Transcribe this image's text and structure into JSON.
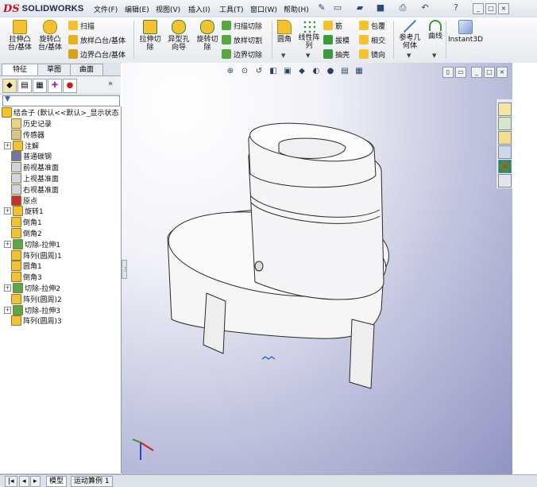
{
  "app": {
    "logo_ds": "DS",
    "logo_name": "SOLIDWORKS"
  },
  "menu": [
    "文件(F)",
    "编辑(E)",
    "视图(V)",
    "插入(I)",
    "工具(T)",
    "窗口(W)",
    "帮助(H)"
  ],
  "toolbar_icons": [
    "pin-icon",
    "new-icon",
    "open-icon",
    "save-icon",
    "print-icon",
    "undo-icon",
    "help-icon"
  ],
  "window_controls": [
    "_",
    "□",
    "×"
  ],
  "features": {
    "extrude_boss": "拉伸凸\n台/基体",
    "revolve_boss": "旋转凸\n台/基体",
    "sweep": "扫描",
    "loft": "放样凸台/基体",
    "boundary": "边界凸台/基体",
    "extrude_cut": "拉伸切\n除",
    "hole_wizard": "异型孔\n向导",
    "revolve_cut": "旋转切\n除",
    "swept_cut": "扫描切除",
    "lofted_cut": "放样切割",
    "boundary_cut": "边界切除",
    "fillet": "圆角",
    "linear_pattern": "线性阵\n列",
    "rib": "筋",
    "draft": "拔模",
    "shell": "抽壳",
    "wrap": "包覆",
    "intersect": "相交",
    "mirror": "镜向",
    "ref_geometry": "参考几\n何体",
    "curves": "曲线",
    "instant3d": "Instant3D"
  },
  "tabs": {
    "features": "特征",
    "sketch": "草图",
    "surfaces": "曲面"
  },
  "tree": {
    "root": "结合子  (默认<<默认>_显示状态",
    "items": [
      {
        "label": "历史记录",
        "expand": ""
      },
      {
        "label": "传感器",
        "expand": ""
      },
      {
        "label": "注解",
        "expand": "+"
      },
      {
        "label": "普通碳钢",
        "expand": ""
      },
      {
        "label": "前视基准面",
        "expand": ""
      },
      {
        "label": "上视基准面",
        "expand": ""
      },
      {
        "label": "右视基准面",
        "expand": ""
      },
      {
        "label": "原点",
        "expand": ""
      },
      {
        "label": "旋转1",
        "expand": "+"
      },
      {
        "label": "倒角1",
        "expand": ""
      },
      {
        "label": "倒角2",
        "expand": ""
      },
      {
        "label": "切除-拉伸1",
        "expand": "+"
      },
      {
        "label": "阵列(圆周)1",
        "expand": ""
      },
      {
        "label": "圆角1",
        "expand": ""
      },
      {
        "label": "倒角3",
        "expand": ""
      },
      {
        "label": "切除-拉伸2",
        "expand": "+"
      },
      {
        "label": "阵列(圆周)2",
        "expand": ""
      },
      {
        "label": "切除-拉伸3",
        "expand": "+"
      },
      {
        "label": "阵列(圆周)3",
        "expand": ""
      }
    ]
  },
  "bottom_tabs": [
    "模型",
    "运动算例 1"
  ],
  "colors": {
    "accent": "#c8102e",
    "part": "#f7f6f7",
    "edge": "#2a2a2a",
    "sel": "#2a56c6"
  }
}
